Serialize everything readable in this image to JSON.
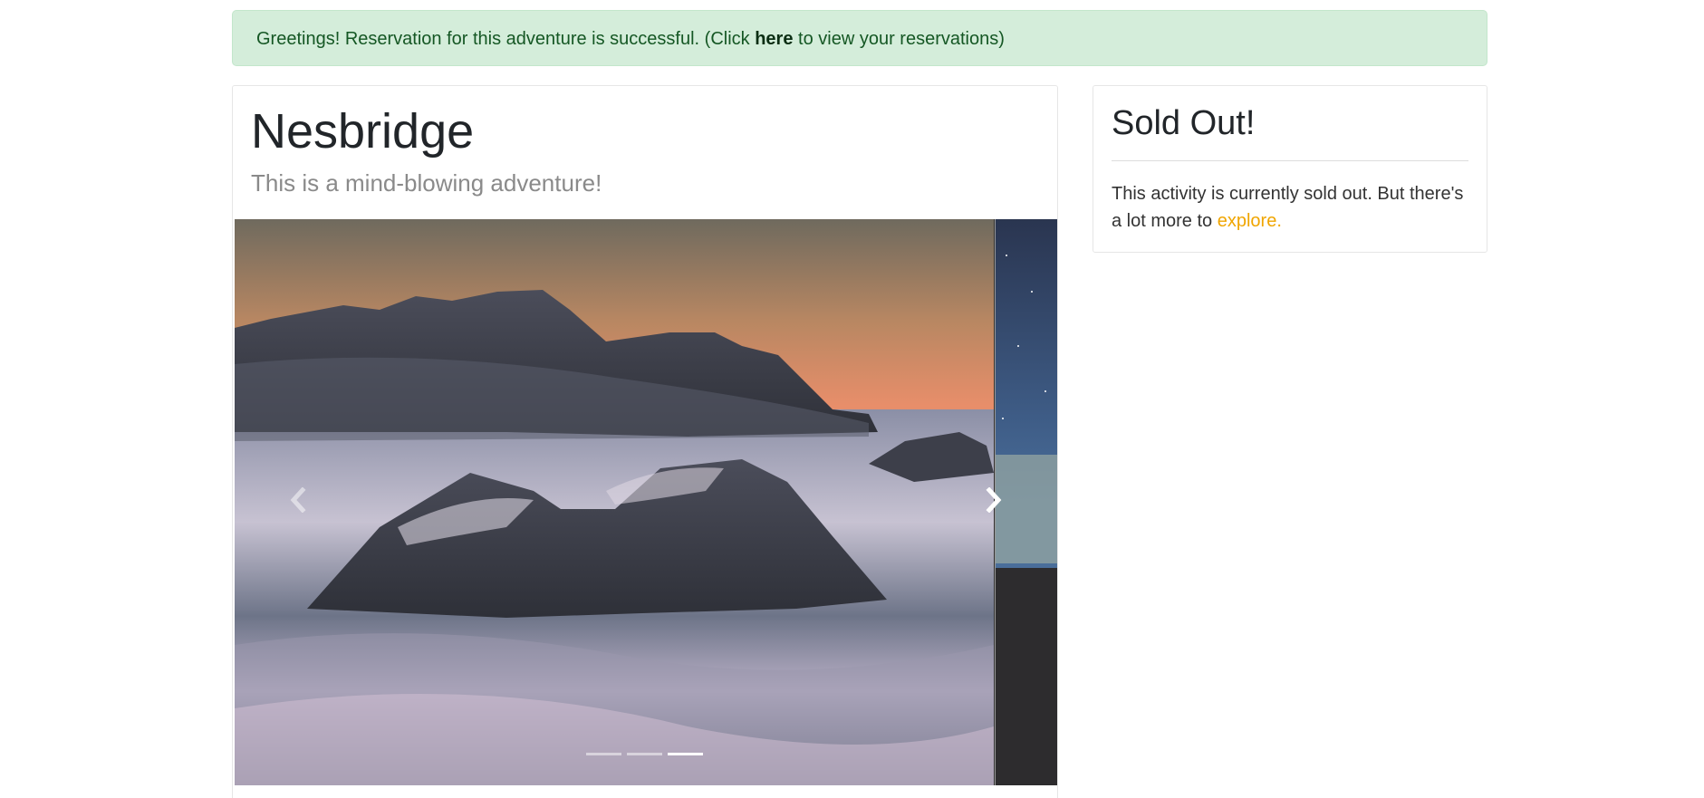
{
  "alert": {
    "text_before": "Greetings! Reservation for this adventure is successful. (Click ",
    "link": "here",
    "text_after": " to view your reservations)"
  },
  "adventure": {
    "name": "Nesbridge",
    "subtitle": "This is a mind-blowing adventure!",
    "carousel": {
      "slide_count": 3,
      "active_index": 2
    }
  },
  "sold_out": {
    "title": "Sold Out!",
    "message": "This activity is currently sold out. But there's a lot more to ",
    "link": "explore."
  },
  "colors": {
    "alert_bg": "#d4edda",
    "alert_text": "#155724",
    "link_accent": "#f0a500"
  }
}
